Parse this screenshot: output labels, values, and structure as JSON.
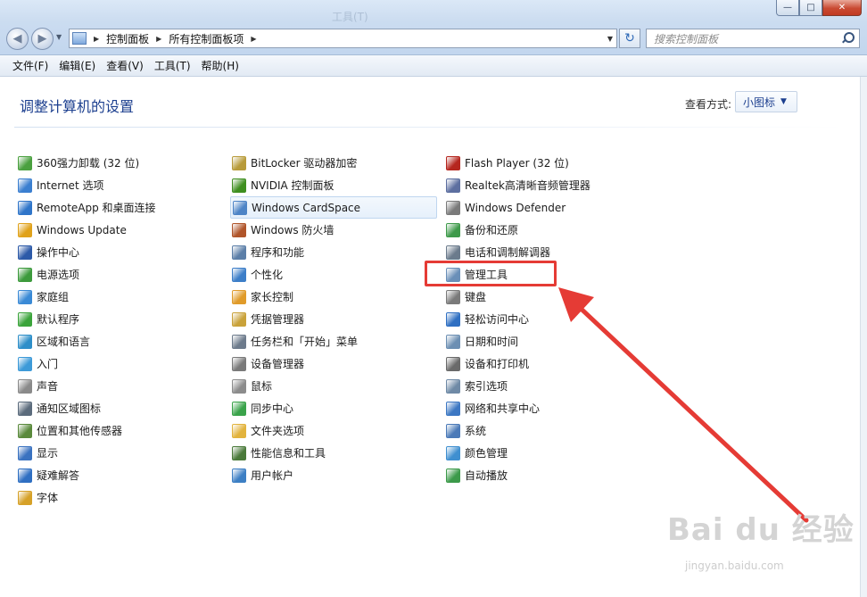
{
  "window": {
    "ghost_title": "工具(T)",
    "buttons": {
      "minimize": "—",
      "maximize": "□",
      "close": "✕"
    }
  },
  "address": {
    "crumbs": [
      "控制面板",
      "所有控制面板项"
    ]
  },
  "search": {
    "placeholder": "搜索控制面板"
  },
  "menu": [
    "文件(F)",
    "编辑(E)",
    "查看(V)",
    "工具(T)",
    "帮助(H)"
  ],
  "header": {
    "title": "调整计算机的设置",
    "view_label": "查看方式:",
    "view_value": "小图标"
  },
  "columns": [
    [
      {
        "label": "360强力卸载 (32 位)",
        "icon": "uninstall-icon",
        "color": "#4aa03f"
      },
      {
        "label": "Internet 选项",
        "icon": "internet-options-icon",
        "color": "#3b7fd0"
      },
      {
        "label": "RemoteApp 和桌面连接",
        "icon": "remoteapp-icon",
        "color": "#2f75c9"
      },
      {
        "label": "Windows Update",
        "icon": "windows-update-icon",
        "color": "#e0a21b"
      },
      {
        "label": "操作中心",
        "icon": "action-center-flag-icon",
        "color": "#2d5aa8"
      },
      {
        "label": "电源选项",
        "icon": "power-options-icon",
        "color": "#3c9a3c"
      },
      {
        "label": "家庭组",
        "icon": "homegroup-icon",
        "color": "#3a8ad6"
      },
      {
        "label": "默认程序",
        "icon": "default-programs-icon",
        "color": "#3ba43b"
      },
      {
        "label": "区域和语言",
        "icon": "region-language-icon",
        "color": "#2e8fc9"
      },
      {
        "label": "入门",
        "icon": "getting-started-icon",
        "color": "#3d9ad8"
      },
      {
        "label": "声音",
        "icon": "sound-icon",
        "color": "#8a8a8a"
      },
      {
        "label": "通知区域图标",
        "icon": "notification-area-icon",
        "color": "#5b6b7c"
      },
      {
        "label": "位置和其他传感器",
        "icon": "location-sensors-icon",
        "color": "#5a8a3c"
      },
      {
        "label": "显示",
        "icon": "display-icon",
        "color": "#3a72c0"
      },
      {
        "label": "疑难解答",
        "icon": "troubleshooting-icon",
        "color": "#2f6fc2"
      },
      {
        "label": "字体",
        "icon": "fonts-icon",
        "color": "#d6a128"
      }
    ],
    [
      {
        "label": "BitLocker 驱动器加密",
        "icon": "bitlocker-icon",
        "color": "#b89b3a"
      },
      {
        "label": "NVIDIA 控制面板",
        "icon": "nvidia-icon",
        "color": "#3f8f20"
      },
      {
        "label": "Windows CardSpace",
        "icon": "cardspace-icon",
        "color": "#4d84c6"
      },
      {
        "label": "Windows 防火墙",
        "icon": "firewall-icon",
        "color": "#b0552a"
      },
      {
        "label": "程序和功能",
        "icon": "programs-features-icon",
        "color": "#5c7fa8"
      },
      {
        "label": "个性化",
        "icon": "personalization-icon",
        "color": "#3c7ec8"
      },
      {
        "label": "家长控制",
        "icon": "parental-controls-icon",
        "color": "#e09b2a"
      },
      {
        "label": "凭据管理器",
        "icon": "credential-manager-icon",
        "color": "#c9a23a"
      },
      {
        "label": "任务栏和「开始」菜单",
        "icon": "taskbar-icon",
        "color": "#6d7b8c"
      },
      {
        "label": "设备管理器",
        "icon": "device-manager-icon",
        "color": "#7a7a7a"
      },
      {
        "label": "鼠标",
        "icon": "mouse-icon",
        "color": "#8c8c8c"
      },
      {
        "label": "同步中心",
        "icon": "sync-center-icon",
        "color": "#3aa34a"
      },
      {
        "label": "文件夹选项",
        "icon": "folder-options-icon",
        "color": "#e2b33d"
      },
      {
        "label": "性能信息和工具",
        "icon": "performance-icon",
        "color": "#4a7a3a"
      },
      {
        "label": "用户帐户",
        "icon": "user-accounts-icon",
        "color": "#3d7fc4"
      }
    ],
    [
      {
        "label": "Flash Player (32 位)",
        "icon": "flash-player-icon",
        "color": "#b5261e"
      },
      {
        "label": "Realtek高清晰音频管理器",
        "icon": "realtek-audio-icon",
        "color": "#5d6fa0"
      },
      {
        "label": "Windows Defender",
        "icon": "defender-icon",
        "color": "#7a7a7a"
      },
      {
        "label": "备份和还原",
        "icon": "backup-restore-icon",
        "color": "#3e9a4a"
      },
      {
        "label": "电话和调制解调器",
        "icon": "phone-modem-icon",
        "color": "#6b7b8c"
      },
      {
        "label": "管理工具",
        "icon": "administrative-tools-icon",
        "color": "#6a8fb8"
      },
      {
        "label": "键盘",
        "icon": "keyboard-icon",
        "color": "#7a7a7a"
      },
      {
        "label": "轻松访问中心",
        "icon": "ease-of-access-icon",
        "color": "#2f6fc2"
      },
      {
        "label": "日期和时间",
        "icon": "date-time-icon",
        "color": "#6c8fb3"
      },
      {
        "label": "设备和打印机",
        "icon": "devices-printers-icon",
        "color": "#6a6a6a"
      },
      {
        "label": "索引选项",
        "icon": "indexing-options-icon",
        "color": "#6f8aa6"
      },
      {
        "label": "网络和共享中心",
        "icon": "network-sharing-icon",
        "color": "#3c77c3"
      },
      {
        "label": "系统",
        "icon": "system-icon",
        "color": "#4b7ab8"
      },
      {
        "label": "颜色管理",
        "icon": "color-management-icon",
        "color": "#3f8fd0"
      },
      {
        "label": "自动播放",
        "icon": "autoplay-icon",
        "color": "#3c9a4a"
      }
    ]
  ],
  "hovered_item": "Windows CardSpace",
  "highlighted_item": "管理工具",
  "annotation_color": "#e53b35",
  "watermark": {
    "main": "Bai du 经验",
    "sub": "jingyan.baidu.com"
  }
}
